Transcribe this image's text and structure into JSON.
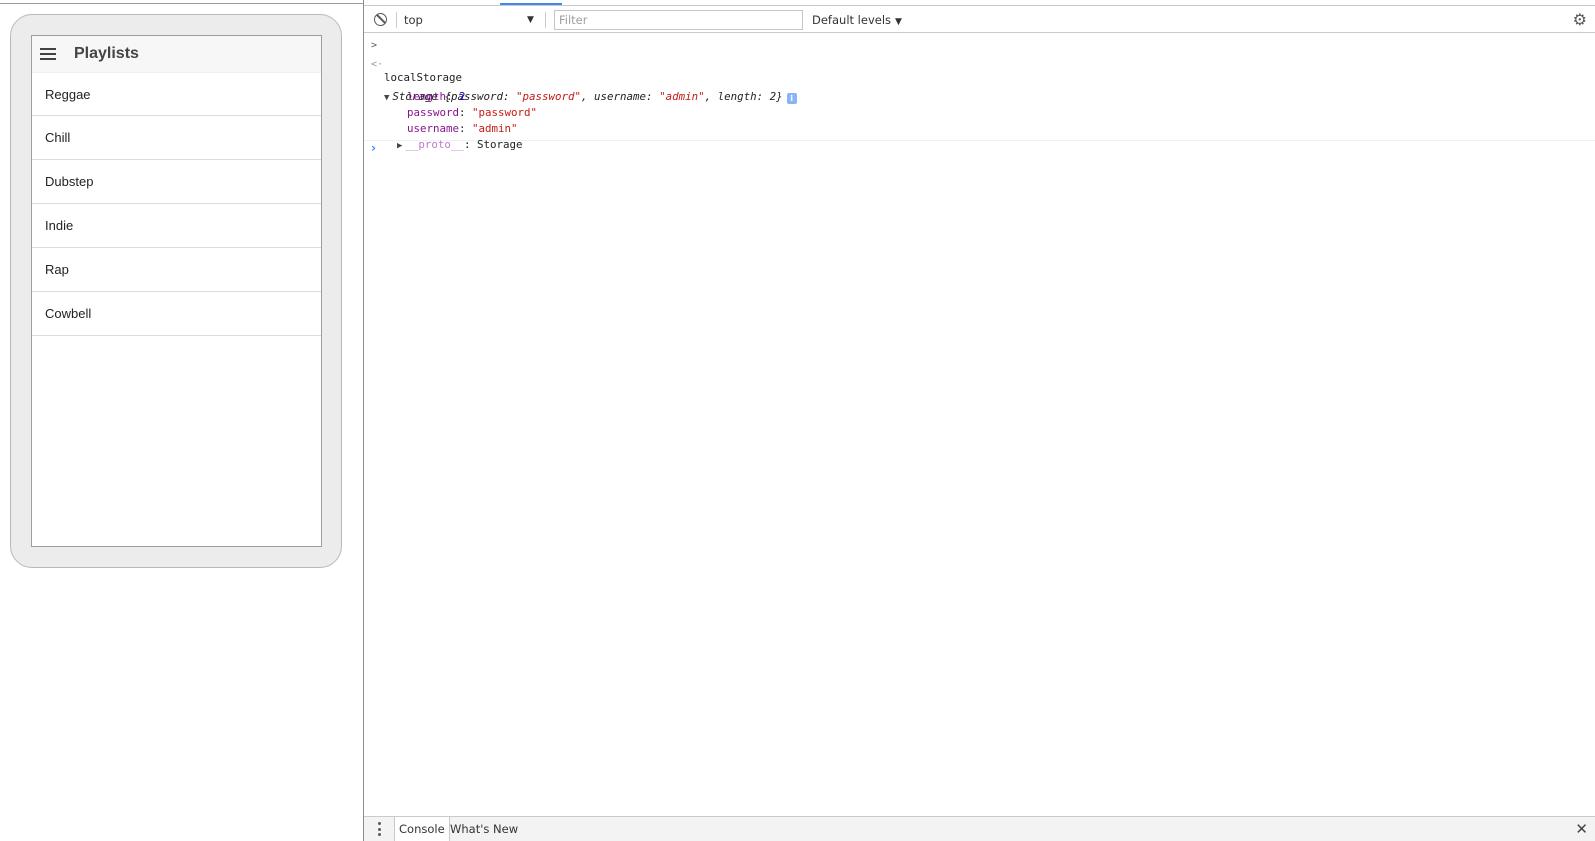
{
  "preview": {
    "header": {
      "title": "Playlists",
      "menu_icon": "hamburger-menu-icon"
    },
    "playlists": [
      {
        "label": "Reggae"
      },
      {
        "label": "Chill"
      },
      {
        "label": "Dubstep"
      },
      {
        "label": "Indie"
      },
      {
        "label": "Rap"
      },
      {
        "label": "Cowbell"
      }
    ]
  },
  "devtools": {
    "toolbar": {
      "clear_icon": "clear-console-icon",
      "context": "top",
      "context_arrow": "▼",
      "filter_placeholder": "Filter",
      "filter_value": "",
      "levels": "Default levels",
      "levels_arrow": "▼",
      "settings_icon": "gear-icon"
    },
    "console": {
      "command": "localStorage",
      "result": {
        "class_name": "Storage",
        "preview_open": "{",
        "preview_close": "}",
        "preview_entries": [
          {
            "key": "password",
            "value": "\"password\"",
            "type": "string"
          },
          {
            "key": "username",
            "value": "\"admin\"",
            "type": "string"
          },
          {
            "key": "length",
            "value": "2",
            "type": "number"
          }
        ],
        "properties": [
          {
            "key": "length",
            "value": "2",
            "type": "number"
          },
          {
            "key": "password",
            "value": "\"password\"",
            "type": "string"
          },
          {
            "key": "username",
            "value": "\"admin\"",
            "type": "string"
          }
        ],
        "proto": {
          "key": "__proto__",
          "value": "Storage"
        },
        "info_badge": "i"
      },
      "input_prompt": "›"
    },
    "drawer": {
      "tabs": [
        {
          "label": "Console",
          "active": true
        },
        {
          "label": "What's New",
          "active": false
        }
      ],
      "close": "✕"
    }
  },
  "colors": {
    "accent": "#4285f4",
    "property_key": "#881391",
    "string_value": "#c41a16",
    "number_value": "#1c00cf"
  }
}
